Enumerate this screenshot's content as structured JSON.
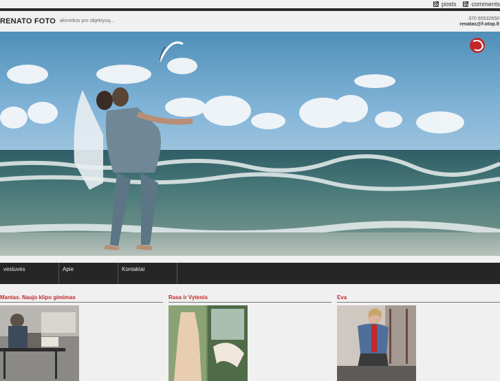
{
  "feed": {
    "posts_label": "posts",
    "comments_label": "comments",
    "icon": "rss-icon"
  },
  "header": {
    "title": "RENATO FOTO",
    "tagline": "akimirkos pro objektyvą...",
    "phone": "370 65532650",
    "email": "renatas@f-otop.lt"
  },
  "hero": {
    "description_icon": "photo-banner",
    "logo": "logo-mark"
  },
  "nav": {
    "items": [
      {
        "label": "vestuvės"
      },
      {
        "label": "Apie"
      },
      {
        "label": "Kontaktai"
      }
    ]
  },
  "posts": [
    {
      "title": "Mantas. Naujo klipo gimimas"
    },
    {
      "title": "Rasa ir Vytenis"
    },
    {
      "title": "Eva"
    }
  ],
  "colors": {
    "accent_red": "#c0282a",
    "nav_bg": "#262626",
    "page_bg": "#f0f0f0"
  }
}
